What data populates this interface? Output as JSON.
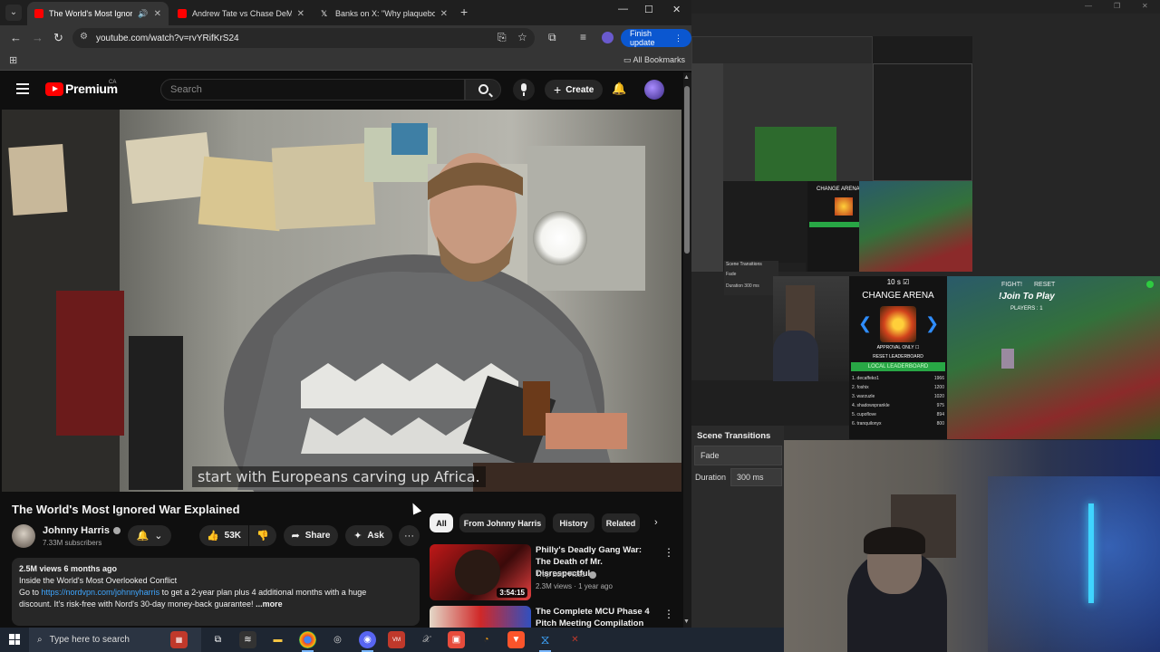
{
  "browser": {
    "tabs": [
      {
        "title": "The World's Most Ignored V",
        "color": "#ff0000",
        "active": true
      },
      {
        "title": "Andrew Tate vs Chase DeMoor",
        "color": "#ff0000",
        "active": false
      },
      {
        "title": "Banks on X: \"Why plaqueboym",
        "color": "#ffffff",
        "active": false
      }
    ],
    "url": "youtube.com/watch?v=rvYRifKrS24",
    "finish_update": "Finish update",
    "all_bookmarks": "All Bookmarks"
  },
  "youtube": {
    "brand": "Premium",
    "country": "CA",
    "search_placeholder": "Search",
    "create_label": "Create",
    "caption": "start with Europeans carving up Africa.",
    "video_title": "The World's Most Ignored War Explained",
    "channel_name": "Johnny Harris",
    "subscribers": "7.33M subscribers",
    "likes": "53K",
    "share_label": "Share",
    "ask_label": "Ask",
    "description": {
      "meta": "2.5M views  6 months ago",
      "line1": "Inside the World's Most Overlooked Conflict",
      "line2_prefix": "Go to ",
      "link": "https://nordvpn.com/johnnyharris",
      "line2_suffix": " to get a 2-year plan plus 4 additional months with a huge",
      "line3": "discount. It's risk-free with Nord's 30-day money-back guarantee!",
      "more": "...more"
    },
    "chips": [
      "All",
      "From Johnny Harris",
      "History",
      "Related"
    ],
    "recommendations": [
      {
        "title": "Philly's Deadly Gang War: The Death of Mr. Disrespectful",
        "channel": "Trap Lore Ross",
        "views": "2.3M views · 1 year ago",
        "duration": "3:54:15"
      },
      {
        "title": "The Complete MCU Phase 4 Pitch Meeting Compilation",
        "channel": "",
        "views": "",
        "duration": ""
      }
    ]
  },
  "obs": {
    "scene_transitions_title": "Scene Transitions",
    "transition": "Fade",
    "duration_label": "Duration",
    "duration_value": "300 ms",
    "arena": {
      "timer": "10 s",
      "title": "CHANGE ARENA",
      "approval": "APPROVAL ONLY",
      "reset_lb": "RESET LEADERBOARD",
      "local_lb": "LOCAL LEADERBOARD",
      "rows": [
        {
          "name": "1. decaffeko1",
          "score": "1966"
        },
        {
          "name": "2. foshix",
          "score": "1200"
        },
        {
          "name": "3. warzuzle",
          "score": "1020"
        },
        {
          "name": "4. shadowsprankle",
          "score": "975"
        },
        {
          "name": "5. cupoflove",
          "score": "894"
        },
        {
          "name": "6. tranquilonyx",
          "score": "800"
        }
      ]
    },
    "game": {
      "fight": "FIGHT!",
      "reset": "RESET",
      "join": "!Join To Play",
      "players": "PLAYERS : 1"
    },
    "mini": {
      "scene_label": "Scene Transitions",
      "fade": "Fade",
      "duration": "Duration",
      "ms": "300 ms"
    }
  },
  "taskbar": {
    "search_placeholder": "Type here to search"
  }
}
